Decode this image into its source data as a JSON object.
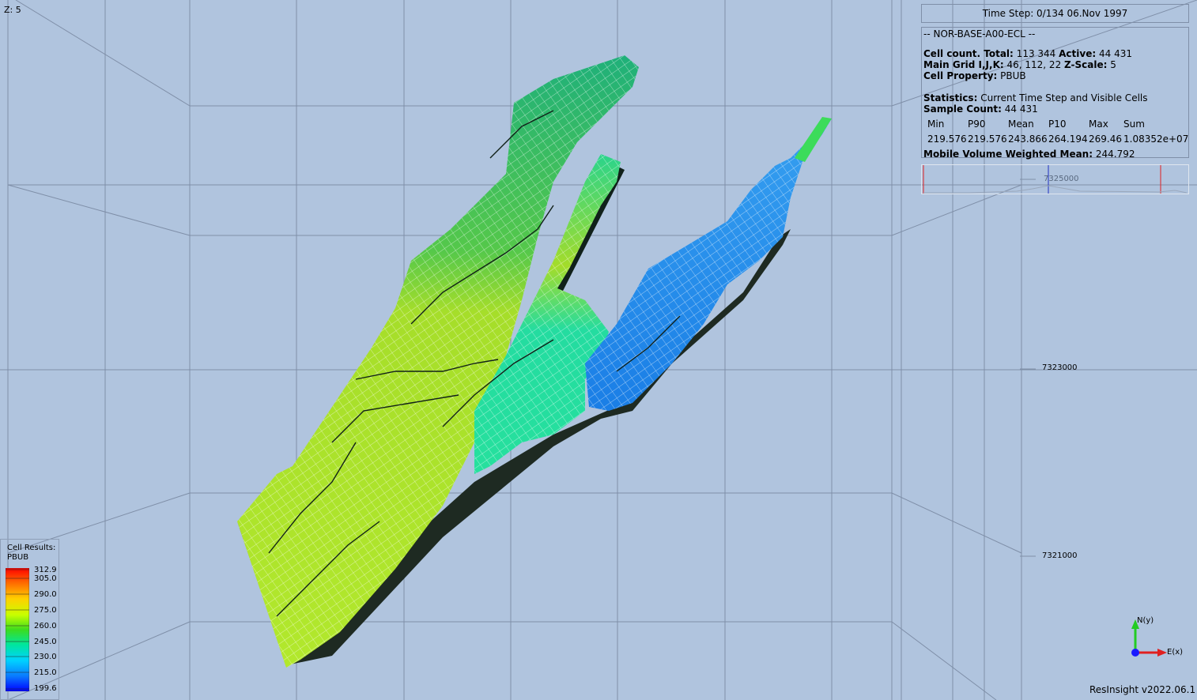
{
  "viewport": {
    "z_scale_label": "Z: 5",
    "y_axis_labels": [
      "7325000",
      "7323000",
      "7321000"
    ]
  },
  "info": {
    "timestep": "Time Step: 0/134 06.Nov 1997",
    "case_name": "-- NOR-BASE-A00-ECL --",
    "cell_count_label": "Cell count. Total:",
    "cell_count_total": "113 344",
    "active_label": "Active:",
    "active_count": "44 431",
    "main_grid_label": "Main Grid I,J,K:",
    "main_grid_value": "46, 112, 22",
    "zscale_label": "Z-Scale:",
    "zscale_value": "5",
    "cell_property_label": "Cell Property:",
    "cell_property_value": "PBUB",
    "statistics_label": "Statistics:",
    "statistics_value": "Current Time Step and Visible Cells",
    "sample_count_label": "Sample Count:",
    "sample_count_value": "44 431",
    "stats_headers": [
      "Min",
      "P90",
      "Mean",
      "P10",
      "Max",
      "Sum"
    ],
    "stats_values": [
      "219.576",
      "219.576",
      "243.866",
      "264.194",
      "269.46",
      "1.08352e+07"
    ],
    "mobile_label": "Mobile Volume Weighted Mean:",
    "mobile_value": "244.792"
  },
  "legend": {
    "title1": "Cell Results:",
    "title2": "PBUB",
    "ticks": [
      "312.9",
      "305.0",
      "290.0",
      "275.0",
      "260.0",
      "245.0",
      "230.0",
      "215.0",
      "199.6"
    ],
    "colors": [
      "#ff0000",
      "#ff6a00",
      "#ffd000",
      "#c8ff00",
      "#3cdc1e",
      "#00e69b",
      "#00d2ff",
      "#0a78ff",
      "#0000ff"
    ]
  },
  "axes_gizmo": {
    "north_label": "N(y)",
    "east_label": "E(x)"
  },
  "footer": {
    "version": "ResInsight v2022.06.1"
  },
  "colors": {
    "background": "#b0c4de",
    "grid_line": "#7f8fa8"
  }
}
